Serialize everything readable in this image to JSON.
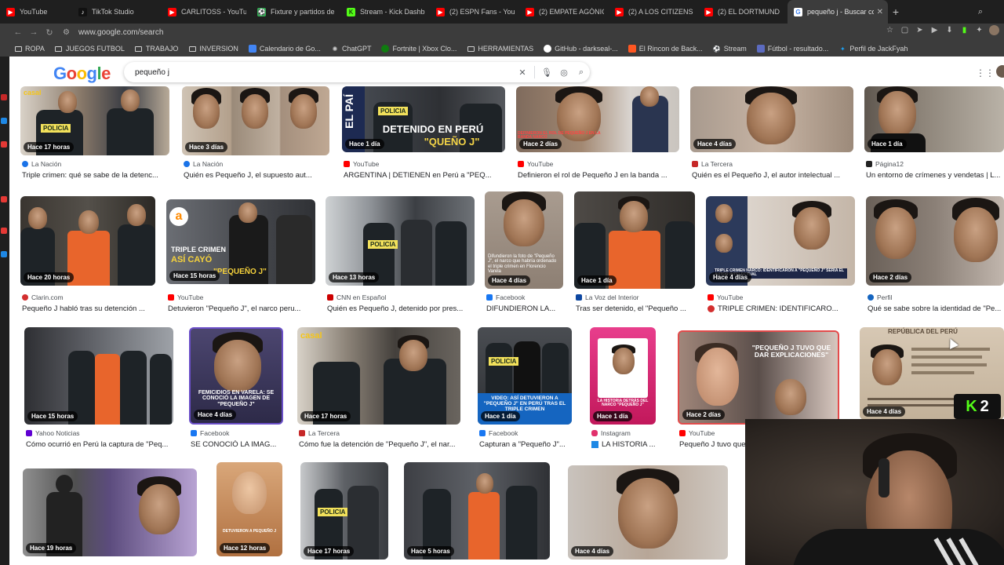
{
  "tabs": [
    {
      "title": "YouTube",
      "color": "#ff0000"
    },
    {
      "title": "TikTok Studio",
      "color": "#111111"
    },
    {
      "title": "CARLITOSS - YouTube",
      "color": "#ff0000"
    },
    {
      "title": "Fixture y partidos de",
      "color": "#34a853"
    },
    {
      "title": "Stream - Kick Dashb",
      "color": "#53fc18"
    },
    {
      "title": "(2) ESPN Fans - You",
      "color": "#ff0000"
    },
    {
      "title": "(2) EMPATE AGÓNIC",
      "color": "#ff0000"
    },
    {
      "title": "(2) A LOS CITIZENS",
      "color": "#ff0000"
    },
    {
      "title": "(2) EL DORTMUND",
      "color": "#ff0000"
    },
    {
      "title": "pequeño j - Buscar con G",
      "color": "#4285f4",
      "active": true
    }
  ],
  "address": {
    "url": "www.google.com/search"
  },
  "bookmarks": [
    {
      "label": "ROPA",
      "type": "folder"
    },
    {
      "label": "JUEGOS FUTBOL",
      "type": "folder"
    },
    {
      "label": "TRABAJO",
      "type": "folder"
    },
    {
      "label": "INVERSION",
      "type": "folder"
    },
    {
      "label": "Calendario de Go...",
      "type": "site",
      "color": "#4285f4"
    },
    {
      "label": "ChatGPT",
      "type": "site",
      "color": "#cccccc"
    },
    {
      "label": "Fortnite | Xbox Clo...",
      "type": "site",
      "color": "#107c10"
    },
    {
      "label": "HERRAMIENTAS",
      "type": "folder"
    },
    {
      "label": "GitHub - darkseal-...",
      "type": "site",
      "color": "#ffffff"
    },
    {
      "label": "El Rincon de Back...",
      "type": "site",
      "color": "#ff5722"
    },
    {
      "label": "Stream",
      "type": "site",
      "color": "#ffffff"
    },
    {
      "label": "Fútbol - resultado...",
      "type": "site",
      "color": "#5c6bc0"
    },
    {
      "label": "Perfil de JackFyah",
      "type": "site",
      "color": "#1da1f2"
    }
  ],
  "search": {
    "query": "pequeño j",
    "logo": "Google"
  },
  "results": [
    {
      "source": "La Nación",
      "caption": "Triple crimen: qué se sabe de la detenc...",
      "time": "Hace 17 horas",
      "color": "#1a73e8"
    },
    {
      "source": "La Nación",
      "caption": "Quién es Pequeño J, el supuesto aut...",
      "time": "Hace 3 días",
      "color": "#1a73e8"
    },
    {
      "source": "YouTube",
      "caption": "ARGENTINA | DETIENEN en Perú a \"PEQ...",
      "time": "Hace 1 día",
      "color": "#ff0000"
    },
    {
      "source": "YouTube",
      "caption": "Definieron el rol de Pequeño J en la banda ...",
      "time": "Hace 2 días",
      "color": "#ff0000"
    },
    {
      "source": "La Tercera",
      "caption": "Quién es el Pequeño J, el autor intelectual ...",
      "time": "Hace 4 días",
      "color": "#c62828"
    },
    {
      "source": "Página12",
      "caption": "Un entorno de crímenes y vendetas | L...",
      "time": "Hace 1 día",
      "color": "#222222"
    },
    {
      "source": "Clarin.com",
      "caption": "Pequeño J habló tras su detención ...",
      "time": "Hace 20 horas",
      "color": "#d32f2f"
    },
    {
      "source": "YouTube",
      "caption": "Detuvieron \"Pequeño J\", el narco peru...",
      "time": "Hace 15 horas",
      "color": "#ff0000"
    },
    {
      "source": "CNN en Español",
      "caption": "Quién es Pequeño J, detenido por pres...",
      "time": "Hace 13 horas",
      "color": "#cc0000"
    },
    {
      "source": "Facebook",
      "caption": "DIFUNDIERON LA...",
      "time": "Hace 4 días",
      "color": "#1877f2"
    },
    {
      "source": "La Voz del Interior",
      "caption": "Tras ser detenido, el \"Pequeño ...",
      "time": "Hace 1 día",
      "color": "#0d47a1"
    },
    {
      "source": "YouTube",
      "caption": "TRIPLE CRIMEN: IDENTIFICARO...",
      "time": "Hace 4 días",
      "color": "#ff0000"
    },
    {
      "source": "Perfil",
      "caption": "Qué se sabe sobre la identidad de \"Pe...",
      "time": "Hace 2 días",
      "color": "#1565c0"
    },
    {
      "source": "Yahoo Noticias",
      "caption": "Cómo ocurrió en Perú la captura de \"Peq...",
      "time": "Hace 15 horas",
      "color": "#6001d2"
    },
    {
      "source": "Facebook",
      "caption": "SE CONOCIÓ LA IMAG...",
      "time": "Hace 4 días",
      "color": "#1877f2"
    },
    {
      "source": "La Tercera",
      "caption": "Cómo fue la detención de \"Pequeño J\", el nar...",
      "time": "Hace 17 horas",
      "color": "#c62828"
    },
    {
      "source": "Facebook",
      "caption": "Capturan a \"Pequeño J\"...",
      "time": "Hace 1 día",
      "color": "#1877f2"
    },
    {
      "source": "Instagram",
      "caption": "LA HISTORIA ...",
      "time": "Hace 1 día",
      "color": "#e1306c"
    },
    {
      "source": "YouTube",
      "caption": "Pequeño J tuvo que",
      "time": "Hace 2 días",
      "color": "#ff0000"
    },
    {
      "source": "",
      "caption": "",
      "time": "Hace 4 días",
      "color": "#999999"
    },
    {
      "time": "Hace 19 horas"
    },
    {
      "time": "Hace 12 horas"
    },
    {
      "time": "Hace 17 horas"
    },
    {
      "time": "Hace 5 horas"
    },
    {
      "time": "Hace 4 días"
    }
  ],
  "thumb_texts": {
    "policia": "POLICIA",
    "detenido": "DETENIDO EN PERÚ",
    "queno": "\"QUEÑO J\"",
    "triple": "TRIPLE CRIMEN",
    "asi": "ASÍ CAYÓ",
    "pequeno_quote": "\"PEQUEÑO J\"",
    "femicidios": "FEMICIDIOS EN VARELA: SE CONOCIÓ LA IMAGEN DE \"PEQUEÑO J\"",
    "video": "VIDEO: ASÍ DETUVIERON A \"PEQUEÑO J\" EN PERÚ TRAS EL TRIPLE CRIMEN",
    "pequeno_tuvo": "\"PEQUEÑO J TUVO QUE DAR EXPLICACIONES\"",
    "republica": "REPÚBLICA DEL PERÚ",
    "detuvieron": "DETUVIERON A PEQUEÑO J"
  },
  "stream_logo": {
    "letter": "K",
    "count": "2"
  }
}
